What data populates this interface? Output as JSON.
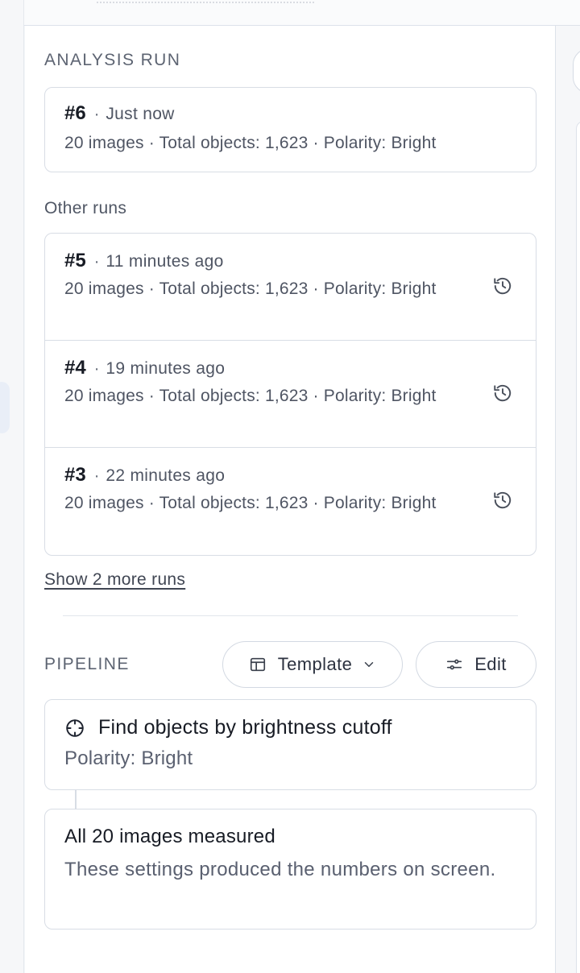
{
  "analysis_run": {
    "section_title": "ANALYSIS RUN",
    "current": {
      "number": "#6",
      "time": "Just now",
      "meta": "20 images · Total objects: 1,623 · Polarity: Bright"
    }
  },
  "other_runs": {
    "heading": "Other runs",
    "items": [
      {
        "number": "#5",
        "time": "11 minutes ago",
        "meta": "20 images · Total objects: 1,623 · Polarity: Bright",
        "icon": "history-icon"
      },
      {
        "number": "#4",
        "time": "19 minutes ago",
        "meta": "20 images · Total objects: 1,623 · Polarity: Bright",
        "icon": "history-icon"
      },
      {
        "number": "#3",
        "time": "22 minutes ago",
        "meta": "20 images · Total objects: 1,623 · Polarity: Bright",
        "icon": "history-icon"
      }
    ],
    "show_more_label": "Show 2 more runs"
  },
  "pipeline": {
    "section_title": "PIPELINE",
    "template_label": "Template",
    "edit_label": "Edit",
    "step": {
      "title": "Find objects by brightness cutoff",
      "subtitle": "Polarity: Bright",
      "icon": "crosshair-icon"
    },
    "summary": {
      "title": "All 20 images measured",
      "subtitle": "These settings produced the numbers on screen."
    }
  },
  "colors": {
    "text_primary": "#171b24",
    "text_muted": "#5a6070",
    "border": "#d8dde5",
    "background": "#f4f6f9"
  }
}
